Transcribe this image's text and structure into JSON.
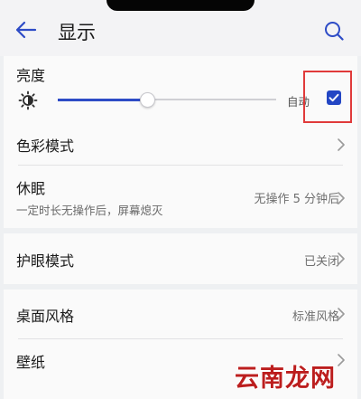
{
  "header": {
    "title": "显示"
  },
  "brightness": {
    "label": "亮度",
    "auto_label": "自动",
    "level_percent": 41,
    "auto_checked": true
  },
  "settings": {
    "color_mode": {
      "label": "色彩模式"
    },
    "sleep": {
      "label": "休眠",
      "description": "一定时长无操作后，屏幕熄灭",
      "value": "无操作 5 分钟后"
    },
    "eye_comfort": {
      "label": "护眼模式",
      "value": "已关闭"
    },
    "desktop_style": {
      "label": "桌面风格",
      "value": "标准风格"
    },
    "wallpaper": {
      "label": "壁纸"
    }
  },
  "watermark": {
    "text": "云南龙网"
  },
  "colors": {
    "accent": "#2d4bc6",
    "highlight": "#e03a3a",
    "watermark": "#bc1e1e"
  },
  "icons": [
    "back-arrow-icon",
    "search-icon",
    "brightness-sun-icon",
    "check-icon",
    "chevron-right-icon"
  ]
}
